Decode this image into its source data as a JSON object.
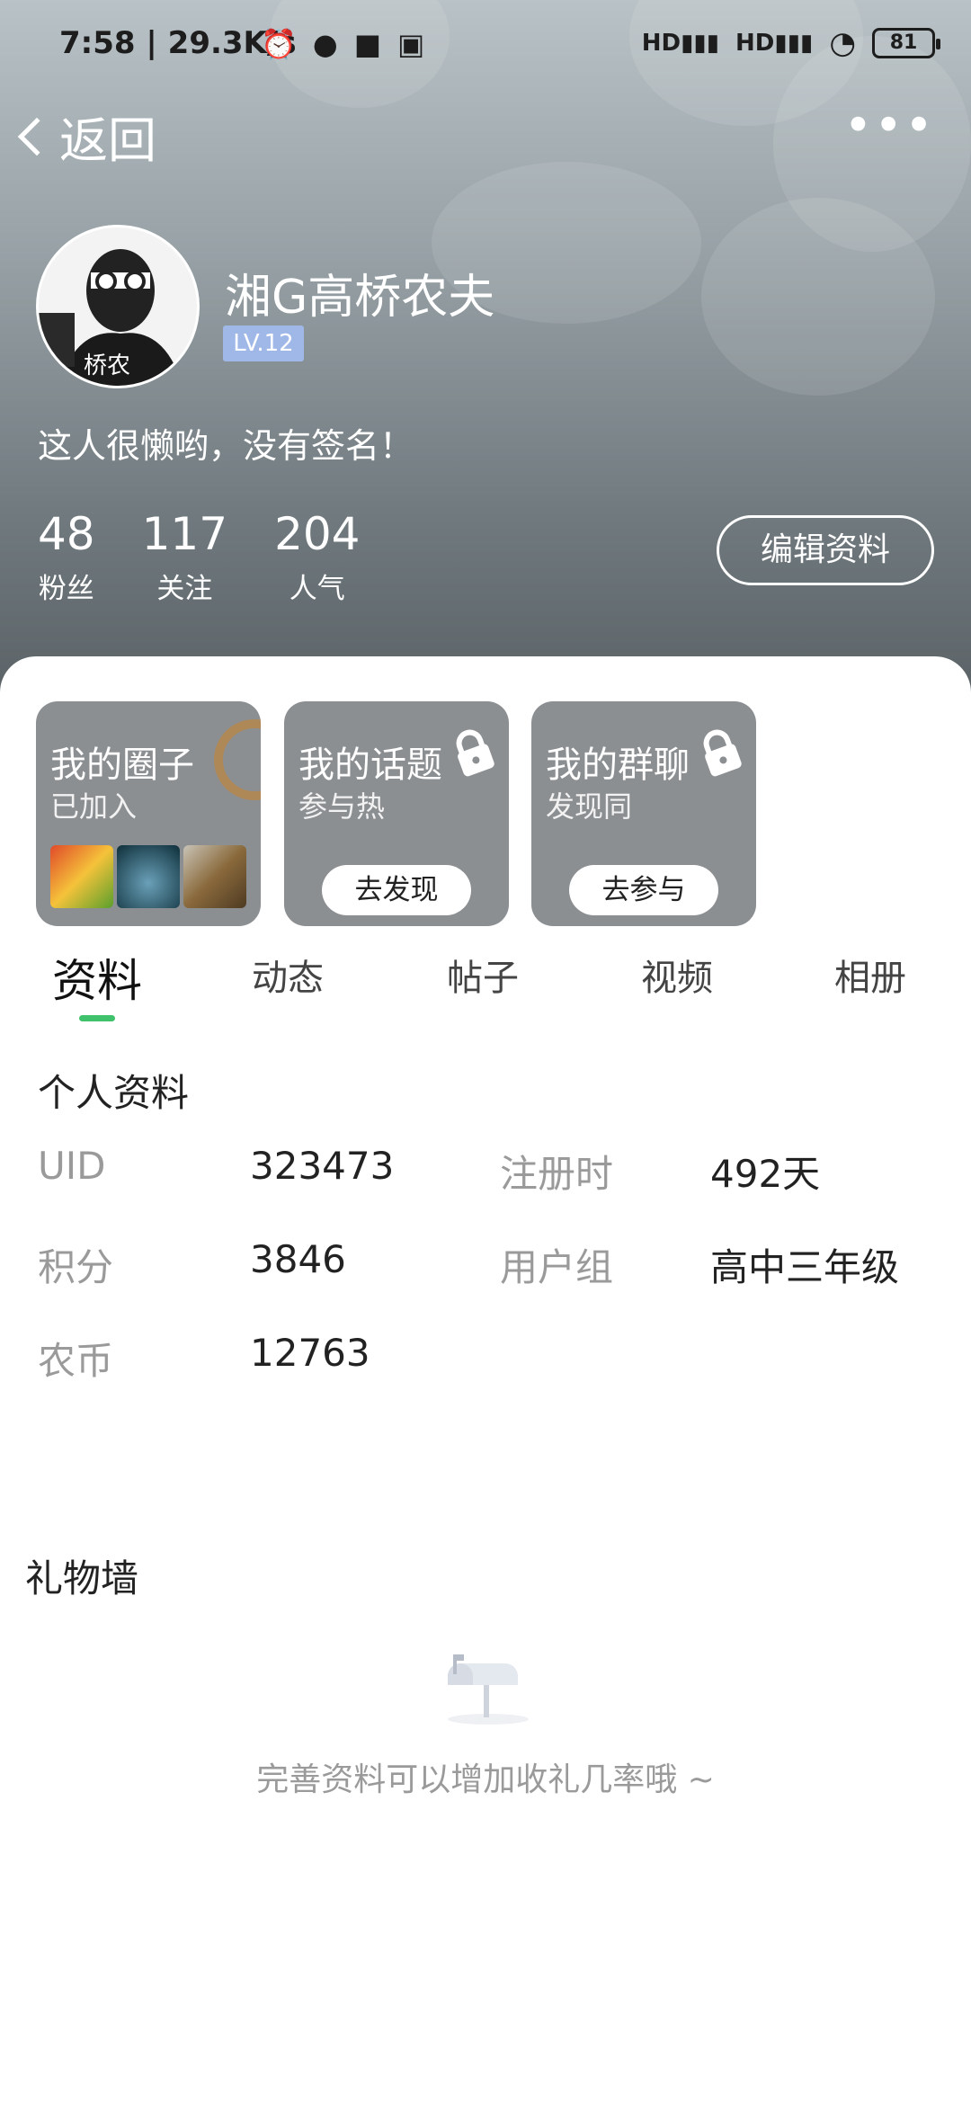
{
  "status_bar": {
    "time": "7:58 | 29.3K/s",
    "icons": [
      "alarm-icon",
      "wechat-icon",
      "message-icon",
      "app-icon"
    ],
    "signal_labels": [
      "HD",
      "HD"
    ],
    "battery": "81"
  },
  "nav": {
    "back_label": "返回",
    "more_label": "•••"
  },
  "profile": {
    "name": "湘G高桥农夫",
    "level": "LV.12",
    "signature": "这人很懒哟，没有签名！",
    "edit_button": "编辑资料",
    "stats": [
      {
        "value": "48",
        "label": "粉丝"
      },
      {
        "value": "117",
        "label": "关注"
      },
      {
        "value": "204",
        "label": "人气"
      }
    ]
  },
  "cards": [
    {
      "title": "我的圈子",
      "subtitle": "已加入",
      "button": ""
    },
    {
      "title": "我的话题",
      "subtitle": "参与热",
      "button": "去发现"
    },
    {
      "title": "我的群聊",
      "subtitle": "发现同",
      "button": "去参与"
    }
  ],
  "tabs": [
    "资料",
    "动态",
    "帖子",
    "视频",
    "相册"
  ],
  "active_tab": "资料",
  "info": {
    "section_title": "个人资料",
    "fields": [
      {
        "label": "UID",
        "value": "323473"
      },
      {
        "label": "注册时",
        "value": "492天"
      },
      {
        "label": "积分",
        "value": "3846"
      },
      {
        "label": "用户组",
        "value": "高中三年级"
      },
      {
        "label": "农币",
        "value": "12763"
      }
    ]
  },
  "gifts": {
    "title": "礼物墙",
    "empty_text": "完善资料可以增加收礼几率哦 ~"
  },
  "colors": {
    "accent": "#3fc26b",
    "level_badge": "#9fb8e8",
    "card_bg": "#8c8f92"
  }
}
